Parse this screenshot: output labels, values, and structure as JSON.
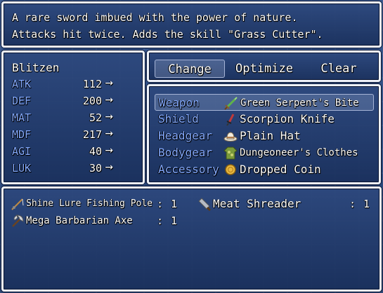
{
  "help_window": {
    "lines": [
      "A rare sword imbued with the power of nature.",
      "Attacks hit twice. Adds the skill \"Grass Cutter\"."
    ]
  },
  "status_window": {
    "actor_name": "Blitzen",
    "stats": [
      {
        "label": "ATK",
        "value": "112",
        "arrow": "→"
      },
      {
        "label": "DEF",
        "value": "200",
        "arrow": "→"
      },
      {
        "label": "MAT",
        "value": "52",
        "arrow": "→"
      },
      {
        "label": "MDF",
        "value": "217",
        "arrow": "→"
      },
      {
        "label": "AGI",
        "value": "40",
        "arrow": "→"
      },
      {
        "label": "LUK",
        "value": "30",
        "arrow": "→"
      }
    ]
  },
  "command_window": {
    "commands": [
      "Change",
      "Optimize",
      "Clear"
    ],
    "selected": "Change"
  },
  "slot_window": {
    "slots": [
      {
        "slot": "Weapon",
        "item": "Green Serpent's Bite",
        "icon": "sword-icon"
      },
      {
        "slot": "Shield",
        "item": "Scorpion Knife",
        "icon": "dagger-icon"
      },
      {
        "slot": "Headgear",
        "item": "Plain Hat",
        "icon": "hat-icon"
      },
      {
        "slot": "Bodygear",
        "item": "Dungeoneer's Clothes",
        "icon": "clothes-icon"
      },
      {
        "slot": "Accessory",
        "item": "Dropped Coin",
        "icon": "coin-icon"
      }
    ],
    "selected": "Weapon"
  },
  "item_window": {
    "items": [
      {
        "name": "Shine Lure Fishing Pole",
        "colon": ":",
        "count": "1",
        "icon": "fishing-pole-icon"
      },
      {
        "name": "Meat Shreader",
        "colon": ":",
        "count": "1",
        "icon": "cleaver-icon"
      },
      {
        "name": "Mega Barbarian Axe",
        "colon": ":",
        "count": "1",
        "icon": "axe-icon"
      }
    ]
  },
  "colors": {
    "system_text": "#84aaff",
    "normal_text": "#ffffff",
    "window_border": "#eef2fa",
    "window_fill": "#233f74"
  }
}
